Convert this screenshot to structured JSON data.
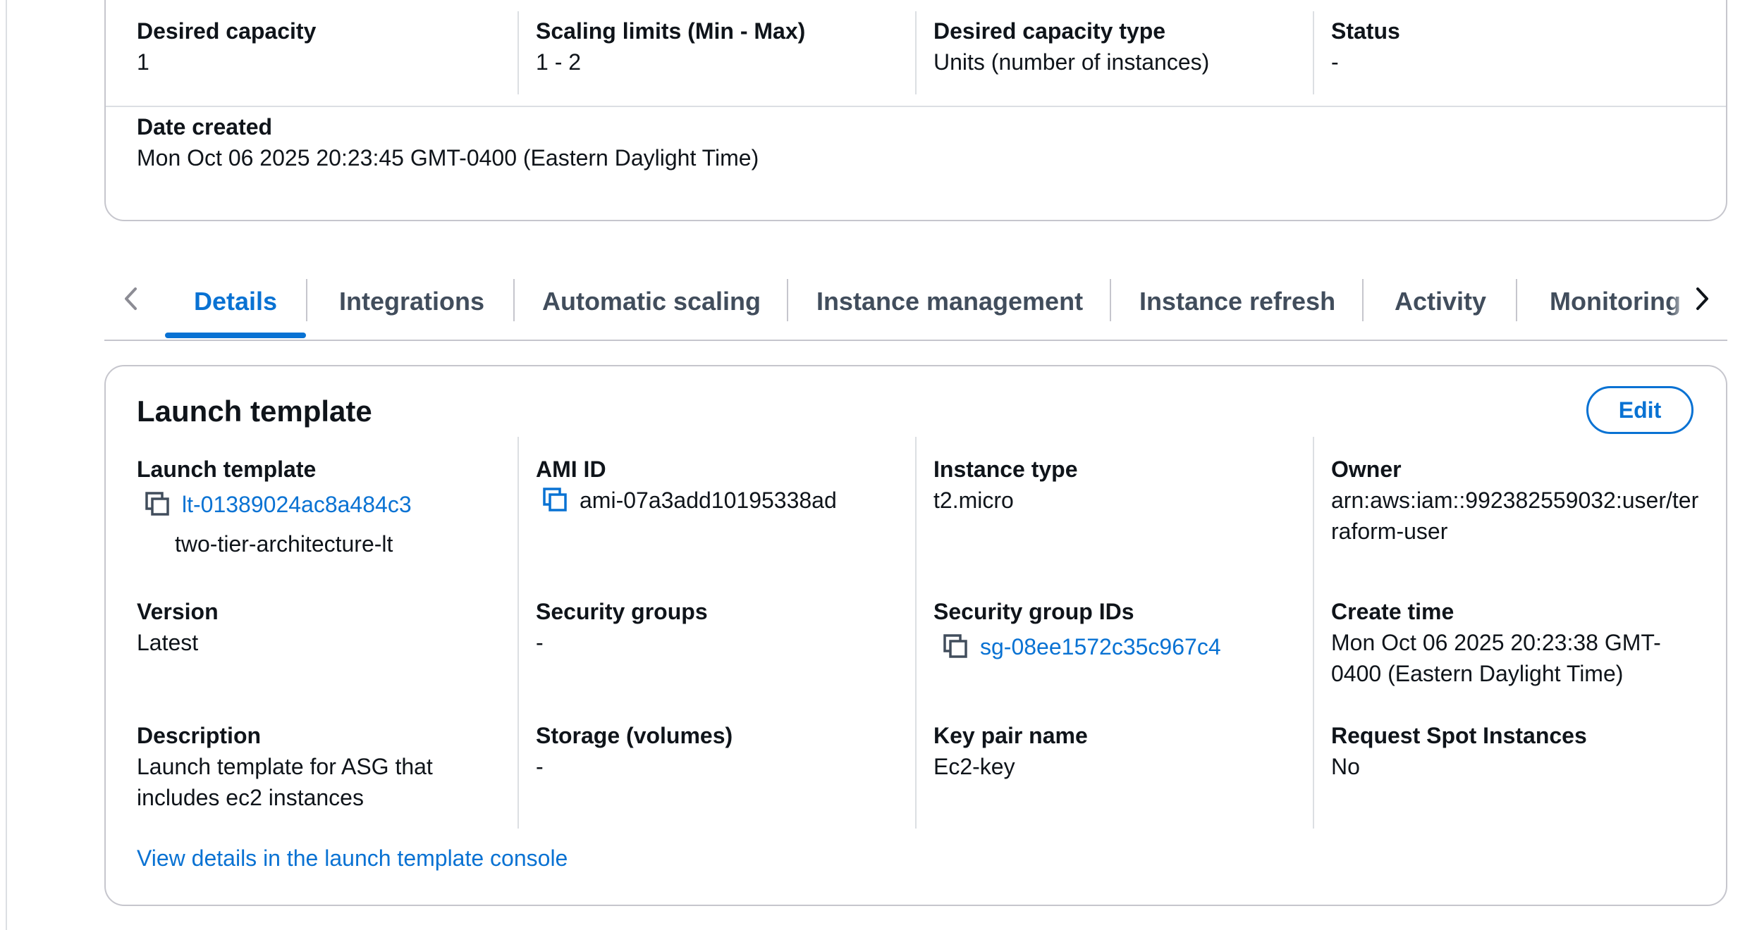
{
  "summary": {
    "desired_capacity": {
      "label": "Desired capacity",
      "value": "1"
    },
    "scaling_limits": {
      "label": "Scaling limits (Min - Max)",
      "value": "1 - 2"
    },
    "desired_capacity_type": {
      "label": "Desired capacity type",
      "value": "Units (number of instances)"
    },
    "status": {
      "label": "Status",
      "value": "-"
    },
    "date_created": {
      "label": "Date created",
      "value": "Mon Oct 06 2025 20:23:45 GMT-0400 (Eastern Daylight Time)"
    }
  },
  "tabs": [
    {
      "label": "Details",
      "active": true
    },
    {
      "label": "Integrations",
      "active": false
    },
    {
      "label": "Automatic scaling",
      "active": false
    },
    {
      "label": "Instance management",
      "active": false
    },
    {
      "label": "Instance refresh",
      "active": false
    },
    {
      "label": "Activity",
      "active": false
    },
    {
      "label": "Monitoring",
      "active": false
    }
  ],
  "launch_template": {
    "title": "Launch template",
    "edit_label": "Edit",
    "fields": {
      "launch_template": {
        "label": "Launch template",
        "id": "lt-01389024ac8a484c3",
        "name": "two-tier-architecture-lt"
      },
      "ami_id": {
        "label": "AMI ID",
        "value": "ami-07a3add10195338ad"
      },
      "instance_type": {
        "label": "Instance type",
        "value": "t2.micro"
      },
      "owner": {
        "label": "Owner",
        "value_line1": "arn:aws:iam::992382559032:user/ter",
        "value_line2": "raform-user"
      },
      "version": {
        "label": "Version",
        "value": "Latest"
      },
      "security_groups": {
        "label": "Security groups",
        "value": "-"
      },
      "security_group_ids": {
        "label": "Security group IDs",
        "value": "sg-08ee1572c35c967c4"
      },
      "create_time": {
        "label": "Create time",
        "value_line1": "Mon Oct 06 2025 20:23:38 GMT-",
        "value_line2": "0400 (Eastern Daylight Time)"
      },
      "description": {
        "label": "Description",
        "value_line1": "Launch template for ASG that",
        "value_line2": "includes ec2 instances"
      },
      "storage": {
        "label": "Storage (volumes)",
        "value": "-"
      },
      "key_pair_name": {
        "label": "Key pair name",
        "value": "Ec2-key"
      },
      "request_spot": {
        "label": "Request Spot Instances",
        "value": "No"
      }
    },
    "view_details_link": "View details in the launch template console"
  },
  "colors": {
    "link": "#0972d3",
    "text": "#0f141a",
    "tab_inactive": "#414d5c",
    "border": "#c6c6cd",
    "divider": "#dcdfe3"
  },
  "icons": {
    "copy": "copy-icon",
    "chevron_left": "chevron-left-icon",
    "chevron_right": "chevron-right-icon"
  }
}
